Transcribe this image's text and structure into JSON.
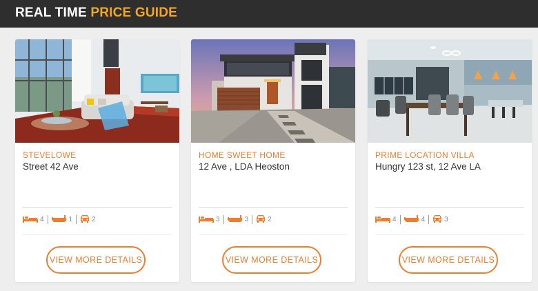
{
  "header": {
    "title_white": "REAL TIME",
    "title_orange": "PRICE GUIDE"
  },
  "colors": {
    "accent": "#ef7d2e",
    "header_bg": "#2e2e2e",
    "title_accent": "#f5a623"
  },
  "listings": [
    {
      "name": "STEVELOWE",
      "address": "Street 42 Ave",
      "beds": "4",
      "baths": "1",
      "cars": "2",
      "button": "VIEW MORE DETAILS",
      "image": "living-room-photo"
    },
    {
      "name": "HOME SWEET HOME",
      "address": "12 Ave , LDA Heoston",
      "beds": "3",
      "baths": "3",
      "cars": "2",
      "button": "VIEW MORE DETAILS",
      "image": "modern-house-exterior-photo"
    },
    {
      "name": "PRIME LOCATION VILLA",
      "address": "Hungry 123 st, 12 Ave LA",
      "beds": "4",
      "baths": "4",
      "cars": "3",
      "button": "VIEW MORE DETAILS",
      "image": "kitchen-dining-photo"
    }
  ],
  "icons": {
    "beds": "bed-icon",
    "baths": "bathtub-icon",
    "cars": "car-icon"
  }
}
